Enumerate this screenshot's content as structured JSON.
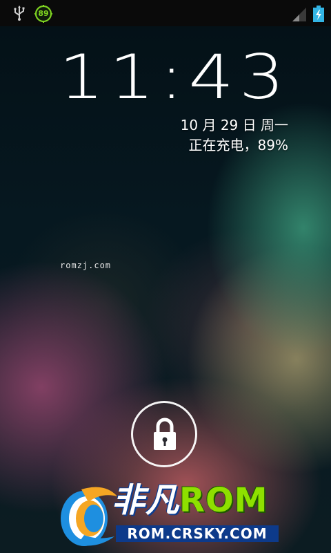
{
  "status_bar": {
    "icons": [
      "usb-icon",
      "battery-percent-icon",
      "signal-icon",
      "charging-icon"
    ],
    "battery_level": "89",
    "accent_color": "#7ed321"
  },
  "lockscreen": {
    "time": "11:43",
    "date": "10 月 29 日 周一",
    "charging_status": "正在充电，89%",
    "owner_info": "romzj.com",
    "unlock_icon": "lock-icon"
  },
  "watermark": {
    "brand_cn": "非凡",
    "brand_rom": "ROM",
    "url": "ROM.CRSKY.COM"
  }
}
